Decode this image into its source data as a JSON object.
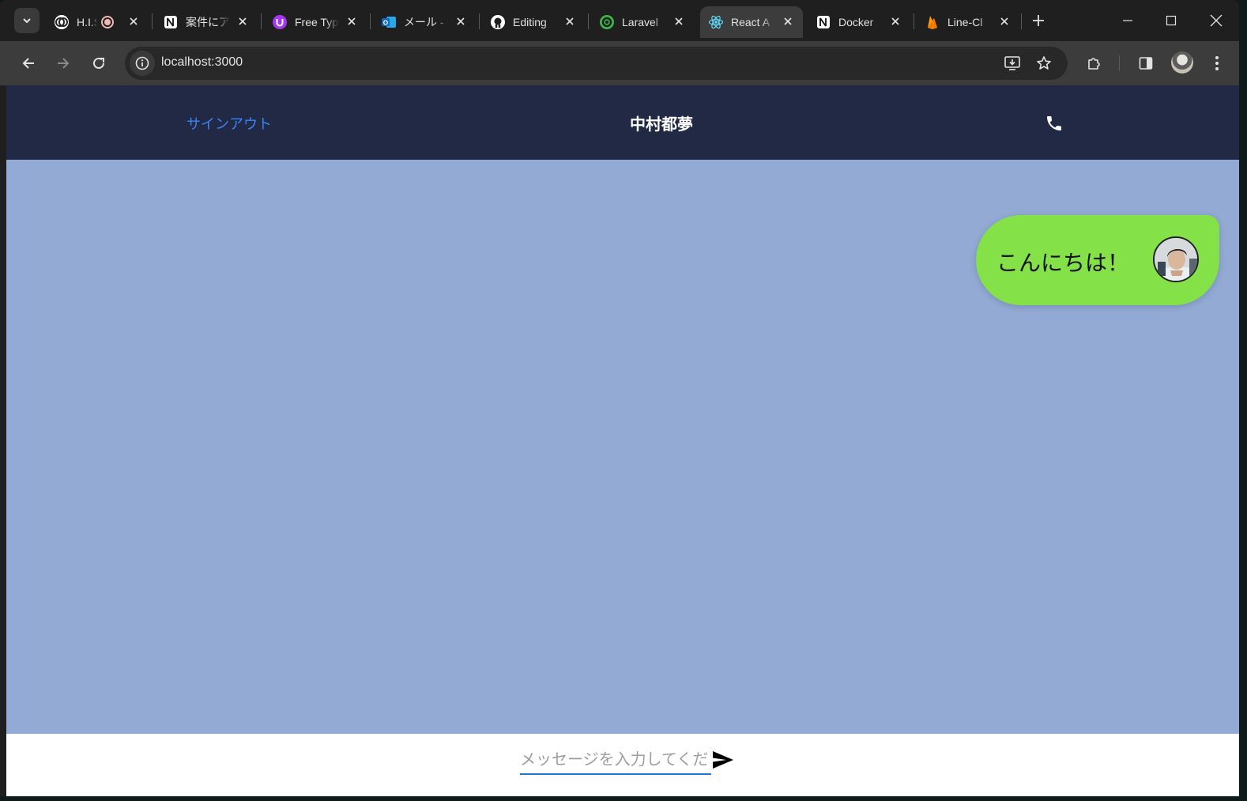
{
  "browser": {
    "tabs": [
      {
        "title": "H.I.S",
        "favicon": "his-logo-icon"
      },
      {
        "title": "案件にア",
        "favicon": "notion-icon"
      },
      {
        "title": "Free Typ",
        "favicon": "udemy-icon"
      },
      {
        "title": "メール - Z",
        "favicon": "outlook-icon"
      },
      {
        "title": "Editing",
        "favicon": "github-icon"
      },
      {
        "title": "Laravel",
        "favicon": "laravel-icon"
      },
      {
        "title": "React A",
        "favicon": "react-icon",
        "active": true
      },
      {
        "title": "Docker",
        "favicon": "notion-icon"
      },
      {
        "title": "Line-Cl",
        "favicon": "firebase-icon"
      }
    ],
    "url": "localhost:3000"
  },
  "header": {
    "signout_label": "サインアウト",
    "chat_partner_name": "中村都夢"
  },
  "messages": [
    {
      "text": "こんにちは！",
      "side": "right",
      "bubble_color": "#84e148"
    }
  ],
  "composer": {
    "placeholder": "メッセージを入力してください",
    "value": ""
  },
  "colors": {
    "header_bg": "#212945",
    "chat_bg": "#93aad4",
    "signout": "#3b82f6",
    "input_underline": "#1976d2"
  }
}
